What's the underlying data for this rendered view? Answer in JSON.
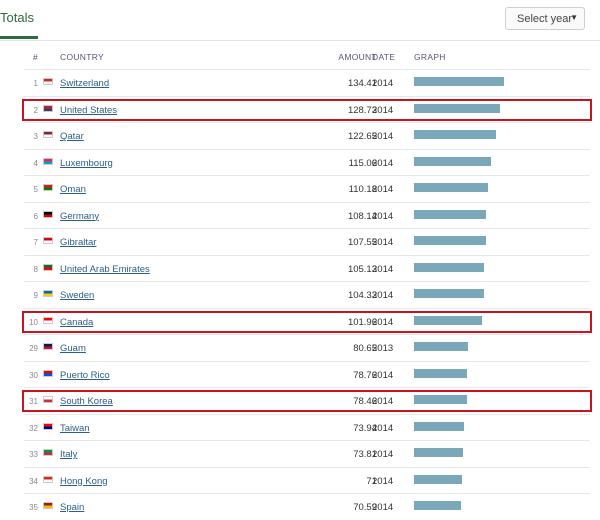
{
  "header": {
    "title": "Totals",
    "select_label": "Select year",
    "select_arrow": "▼"
  },
  "columns": {
    "num": "#",
    "country": "COUNTRY",
    "amount": "AMOUNT",
    "date": "DATE",
    "graph": "GRAPH"
  },
  "rows": [
    {
      "num": "1",
      "country": "Switzerland",
      "amount": "134.41",
      "date": "2014",
      "flag": [
        "#d52b1e",
        "#ffffff"
      ],
      "value": 134.41,
      "highlighted": false
    },
    {
      "num": "2",
      "country": "United States",
      "amount": "128.73",
      "date": "2014",
      "flag": [
        "#b22234",
        "#3c3b6e"
      ],
      "value": 128.73,
      "highlighted": true
    },
    {
      "num": "3",
      "country": "Qatar",
      "amount": "122.65",
      "date": "2014",
      "flag": [
        "#8d1b3d",
        "#ffffff"
      ],
      "value": 122.65,
      "highlighted": false
    },
    {
      "num": "4",
      "country": "Luxembourg",
      "amount": "115.06",
      "date": "2014",
      "flag": [
        "#ed2939",
        "#00a1de"
      ],
      "value": 115.06,
      "highlighted": false
    },
    {
      "num": "5",
      "country": "Oman",
      "amount": "110.18",
      "date": "2014",
      "flag": [
        "#db161b",
        "#008000"
      ],
      "value": 110.18,
      "highlighted": false
    },
    {
      "num": "6",
      "country": "Germany",
      "amount": "108.14",
      "date": "2014",
      "flag": [
        "#000000",
        "#dd0000"
      ],
      "value": 108.14,
      "highlighted": false
    },
    {
      "num": "7",
      "country": "Gibraltar",
      "amount": "107.55",
      "date": "2014",
      "flag": [
        "#da000c",
        "#ffffff"
      ],
      "value": 107.55,
      "highlighted": false
    },
    {
      "num": "8",
      "country": "United Arab Emirates",
      "amount": "105.13",
      "date": "2014",
      "flag": [
        "#00732f",
        "#ff0000"
      ],
      "value": 105.13,
      "highlighted": false
    },
    {
      "num": "9",
      "country": "Sweden",
      "amount": "104.33",
      "date": "2014",
      "flag": [
        "#006aa7",
        "#fecc00"
      ],
      "value": 104.33,
      "highlighted": false
    },
    {
      "num": "10",
      "country": "Canada",
      "amount": "101.96",
      "date": "2014",
      "flag": [
        "#ff0000",
        "#ffffff"
      ],
      "value": 101.96,
      "highlighted": true
    },
    {
      "num": "29",
      "country": "Guam",
      "amount": "80.65",
      "date": "2013",
      "flag": [
        "#00205b",
        "#c8102e"
      ],
      "value": 80.65,
      "highlighted": false
    },
    {
      "num": "30",
      "country": "Puerto Rico",
      "amount": "78.76",
      "date": "2014",
      "flag": [
        "#ed0000",
        "#0050f0"
      ],
      "value": 78.76,
      "highlighted": false
    },
    {
      "num": "31",
      "country": "South Korea",
      "amount": "78.46",
      "date": "2014",
      "flag": [
        "#ffffff",
        "#cd2e3a"
      ],
      "value": 78.46,
      "highlighted": true
    },
    {
      "num": "32",
      "country": "Taiwan",
      "amount": "73.94",
      "date": "2014",
      "flag": [
        "#fe0000",
        "#000095"
      ],
      "value": 73.94,
      "highlighted": false
    },
    {
      "num": "33",
      "country": "Italy",
      "amount": "73.81",
      "date": "2014",
      "flag": [
        "#009246",
        "#ce2b37"
      ],
      "value": 73.81,
      "highlighted": false
    },
    {
      "num": "34",
      "country": "Hong Kong",
      "amount": "71",
      "date": "2014",
      "flag": [
        "#de2910",
        "#ffffff"
      ],
      "value": 71,
      "highlighted": false
    },
    {
      "num": "35",
      "country": "Spain",
      "amount": "70.59",
      "date": "2014",
      "flag": [
        "#aa151b",
        "#f1bf00"
      ],
      "value": 70.59,
      "highlighted": false
    }
  ],
  "colors": {
    "accent": "#2d6a3e",
    "bar": "#7aa8b8",
    "highlight": "#c8141e",
    "link": "#2a5f8a"
  }
}
